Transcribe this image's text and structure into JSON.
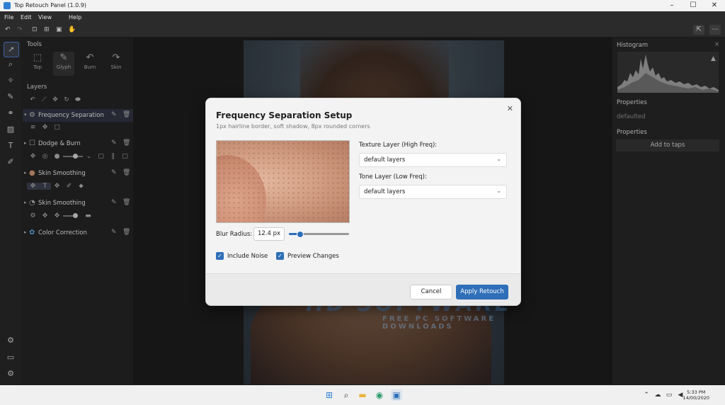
{
  "window": {
    "title": "Top Retouch Panel (1.0.9)"
  },
  "menu": [
    "File",
    "Edit",
    "View",
    "Help"
  ],
  "tools_panel": {
    "title": "Tools",
    "tools": [
      {
        "label": "Top",
        "icon": "crop-icon"
      },
      {
        "label": "Glyph",
        "icon": "brush-icon"
      },
      {
        "label": "Burn",
        "icon": "undo-icon"
      },
      {
        "label": "Skin",
        "icon": "redo-icon"
      }
    ]
  },
  "layers_panel": {
    "title": "Layers",
    "layers": [
      {
        "name": "Frequency Separation",
        "selected": true
      },
      {
        "name": "Dodge & Burn"
      },
      {
        "name": "Skin Smoothing"
      },
      {
        "name": "Skin Smoothing"
      },
      {
        "name": "Color Correction"
      }
    ]
  },
  "right_panel": {
    "histogram_title": "Histogram",
    "properties_title": "Properties",
    "properties_value": "defaulted",
    "properties_title_2": "Properties",
    "add_button": "Add to taps"
  },
  "dialog": {
    "title": "Frequency Separation Setup",
    "subtitle": "1px hairline border, soft shadow, 8px rounded corners",
    "texture_label": "Texture Layer (High Freq):",
    "texture_value": "default layers",
    "tone_label": "Tone Layer (Low Freq):",
    "tone_value": "default layers",
    "blur_label": "Blur Radius:",
    "blur_value": "12.4 px",
    "blur_fraction": 0.18,
    "include_noise": "Include Noise",
    "preview_changes": "Preview Changes",
    "cancel": "Cancel",
    "apply": "Apply Retouch"
  },
  "watermark": {
    "brand": "HD SOFTWARE",
    "tagline": "FREE PC SOFTWARE DOWNLOADS"
  },
  "taskbar": {
    "time": "5:33 PM",
    "date": "14/00/2020"
  },
  "colors": {
    "accent": "#2f6fb8",
    "dark_bg": "#1c1c1c"
  }
}
